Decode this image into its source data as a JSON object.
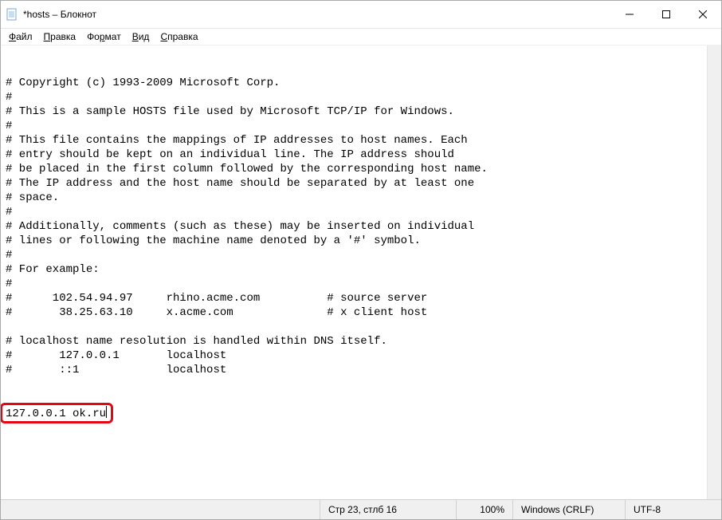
{
  "window": {
    "title": "*hosts – Блокнот"
  },
  "menu": {
    "file": "Файл",
    "edit": "Правка",
    "format": "Формат",
    "view": "Вид",
    "help": "Справка"
  },
  "content": {
    "lines": [
      "# Copyright (c) 1993-2009 Microsoft Corp.",
      "#",
      "# This is a sample HOSTS file used by Microsoft TCP/IP for Windows.",
      "#",
      "# This file contains the mappings of IP addresses to host names. Each",
      "# entry should be kept on an individual line. The IP address should",
      "# be placed in the first column followed by the corresponding host name.",
      "# The IP address and the host name should be separated by at least one",
      "# space.",
      "#",
      "# Additionally, comments (such as these) may be inserted on individual",
      "# lines or following the machine name denoted by a '#' symbol.",
      "#",
      "# For example:",
      "#",
      "#      102.54.94.97     rhino.acme.com          # source server",
      "#       38.25.63.10     x.acme.com              # x client host",
      "",
      "# localhost name resolution is handled within DNS itself.",
      "#       127.0.0.1       localhost",
      "#       ::1             localhost",
      ""
    ],
    "typed_line": "127.0.0.1 ok.ru"
  },
  "statusbar": {
    "position": "Стр 23, стлб 16",
    "zoom": "100%",
    "line_ending": "Windows (CRLF)",
    "encoding": "UTF-8"
  }
}
